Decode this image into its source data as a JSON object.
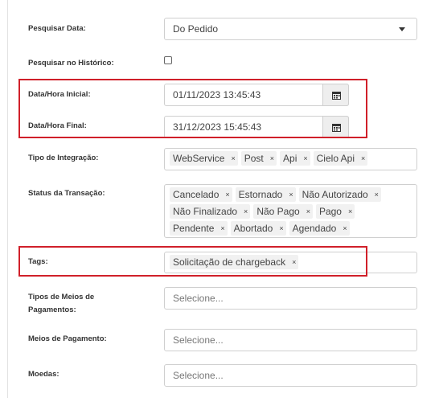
{
  "form": {
    "pesquisar_data": {
      "label": "Pesquisar Data:",
      "value": "Do Pedido"
    },
    "pesquisar_historico": {
      "label": "Pesquisar no Histórico:"
    },
    "data_inicial": {
      "label": "Data/Hora Inicial:",
      "value": "01/11/2023 13:45:43",
      "icon": "calendar-icon"
    },
    "data_final": {
      "label": "Data/Hora Final:",
      "value": "31/12/2023 15:45:43",
      "icon": "calendar-icon"
    },
    "tipo_integracao": {
      "label": "Tipo de Integração:",
      "chips": [
        "WebService",
        "Post",
        "Api",
        "Cielo Api"
      ]
    },
    "status_transacao": {
      "label": "Status da Transação:",
      "chips": [
        "Cancelado",
        "Estornado",
        "Não Autorizado",
        "Não Finalizado",
        "Não Pago",
        "Pago",
        "Pendente",
        "Abortado",
        "Agendado"
      ]
    },
    "tags": {
      "label": "Tags:",
      "chips": [
        "Solicitação de chargeback"
      ]
    },
    "tipos_meios_pagamento": {
      "label_line1": "Tipos de Meios de",
      "label_line2": "Pagamentos:",
      "placeholder": "Selecione..."
    },
    "meios_pagamento": {
      "label": "Meios de Pagamento:",
      "placeholder": "Selecione..."
    },
    "moedas": {
      "label": "Moedas:",
      "placeholder": "Selecione..."
    },
    "chip_remove_glyph": "×"
  },
  "colors": {
    "highlight": "#d0202a",
    "border": "#cfcfcf",
    "chip_bg": "#f1f1f1"
  }
}
